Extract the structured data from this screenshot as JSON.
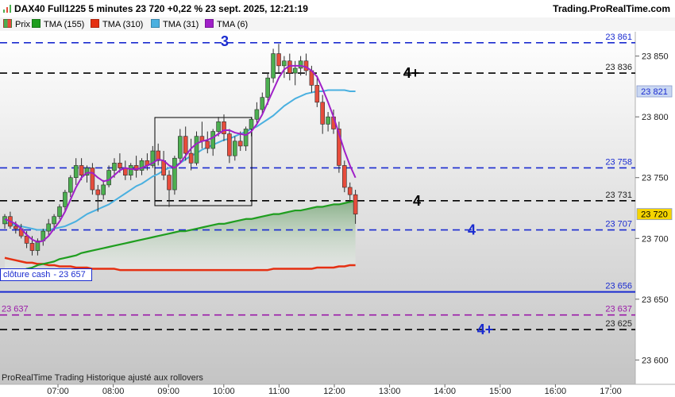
{
  "header": {
    "title": "DAX40 Full1225 5 minutes 23 720 +0,22 % 23 sept. 2025, 12:21:19",
    "source": "Trading.ProRealTime.com"
  },
  "legend": [
    {
      "label": "Prix",
      "color": "#4caf50"
    },
    {
      "label": "TMA (155)",
      "color": "#1f9e1f"
    },
    {
      "label": "TMA (310)",
      "color": "#e53012"
    },
    {
      "label": "TMA (31)",
      "color": "#4ab0e0"
    },
    {
      "label": "TMA (6)",
      "color": "#a020c8"
    }
  ],
  "footnote": "ProRealTime Trading  Historique ajusté aux rollovers",
  "cash_close": {
    "label": "clôture cash",
    "value": "23 657"
  },
  "colors": {
    "up": "#4caf50",
    "down": "#e74c3c",
    "blue_level": "#1a2bd0",
    "black_level": "#000000",
    "purple_level": "#9a1aa8",
    "tma155": "#1f9e1f",
    "tma310": "#e53012",
    "tma31": "#4ab0e0",
    "tma6": "#a020c8"
  },
  "chart_data": {
    "type": "candlestick",
    "y_axis": {
      "min": 23580,
      "max": 23870,
      "ticks": [
        23600,
        23650,
        23700,
        23750,
        23800,
        23850
      ],
      "tick_labels": [
        "23 600",
        "23 650",
        "23 700",
        "23 750",
        "23 800",
        "23 850"
      ]
    },
    "x_axis": {
      "ticks": [
        "07:00",
        "08:00",
        "09:00",
        "10:00",
        "11:00",
        "12:00",
        "13:00",
        "14:00",
        "15:00",
        "16:00",
        "17:00"
      ]
    },
    "levels": [
      {
        "value": 23861,
        "label": "23 861",
        "color": "#1a2bd0",
        "tag": "3",
        "style": "dashed"
      },
      {
        "value": 23836,
        "label": "23 836",
        "color": "#000000",
        "tag": "4+",
        "style": "dashed"
      },
      {
        "value": 23758,
        "label": "23 758",
        "color": "#1a2bd0",
        "tag": "",
        "style": "dashed"
      },
      {
        "value": 23731,
        "label": "23 731",
        "color": "#000000",
        "tag": "4",
        "style": "dashed"
      },
      {
        "value": 23707,
        "label": "23 707",
        "color": "#1a2bd0",
        "tag": "4",
        "style": "dashed"
      },
      {
        "value": 23656,
        "label": "23 656",
        "color": "#1a2bd0",
        "tag": "",
        "style": "solid"
      },
      {
        "value": 23637,
        "label": "23 637",
        "color": "#9a1aa8",
        "tag": "",
        "style": "dashed"
      },
      {
        "value": 23625,
        "label": "23 625",
        "color": "#000000",
        "tag": "4+",
        "style": "dashed"
      }
    ],
    "current_price": {
      "value": 23720,
      "label": "23 720"
    },
    "tma31_last": {
      "value": 23821,
      "label": "23 821"
    },
    "candles": [
      [
        23712,
        23720,
        23708,
        23718
      ],
      [
        23718,
        23722,
        23708,
        23710
      ],
      [
        23710,
        23714,
        23704,
        23708
      ],
      [
        23708,
        23712,
        23700,
        23702
      ],
      [
        23702,
        23706,
        23692,
        23696
      ],
      [
        23696,
        23702,
        23686,
        23690
      ],
      [
        23690,
        23700,
        23686,
        23698
      ],
      [
        23698,
        23708,
        23694,
        23706
      ],
      [
        23706,
        23716,
        23702,
        23712
      ],
      [
        23712,
        23720,
        23708,
        23718
      ],
      [
        23718,
        23728,
        23716,
        23726
      ],
      [
        23726,
        23740,
        23722,
        23738
      ],
      [
        23738,
        23752,
        23734,
        23750
      ],
      [
        23750,
        23766,
        23744,
        23760
      ],
      [
        23760,
        23766,
        23748,
        23752
      ],
      [
        23752,
        23760,
        23746,
        23758
      ],
      [
        23758,
        23762,
        23736,
        23740
      ],
      [
        23740,
        23744,
        23722,
        23736
      ],
      [
        23736,
        23748,
        23732,
        23744
      ],
      [
        23744,
        23760,
        23742,
        23756
      ],
      [
        23756,
        23766,
        23750,
        23762
      ],
      [
        23762,
        23770,
        23754,
        23758
      ],
      [
        23758,
        23764,
        23748,
        23752
      ],
      [
        23752,
        23762,
        23748,
        23760
      ],
      [
        23760,
        23768,
        23750,
        23756
      ],
      [
        23756,
        23766,
        23752,
        23764
      ],
      [
        23764,
        23770,
        23756,
        23760
      ],
      [
        23760,
        23776,
        23758,
        23772
      ],
      [
        23772,
        23778,
        23760,
        23764
      ],
      [
        23764,
        23772,
        23748,
        23752
      ],
      [
        23752,
        23756,
        23726,
        23740
      ],
      [
        23740,
        23768,
        23736,
        23766
      ],
      [
        23766,
        23790,
        23762,
        23784
      ],
      [
        23784,
        23792,
        23764,
        23770
      ],
      [
        23770,
        23782,
        23756,
        23762
      ],
      [
        23762,
        23788,
        23760,
        23784
      ],
      [
        23784,
        23796,
        23774,
        23780
      ],
      [
        23780,
        23788,
        23770,
        23774
      ],
      [
        23774,
        23790,
        23768,
        23788
      ],
      [
        23788,
        23800,
        23784,
        23796
      ],
      [
        23796,
        23802,
        23780,
        23786
      ],
      [
        23786,
        23790,
        23762,
        23768
      ],
      [
        23768,
        23784,
        23764,
        23780
      ],
      [
        23780,
        23788,
        23772,
        23776
      ],
      [
        23776,
        23792,
        23772,
        23790
      ],
      [
        23790,
        23800,
        23784,
        23798
      ],
      [
        23798,
        23812,
        23794,
        23806
      ],
      [
        23806,
        23820,
        23802,
        23816
      ],
      [
        23816,
        23836,
        23810,
        23832
      ],
      [
        23832,
        23856,
        23828,
        23852
      ],
      [
        23852,
        23860,
        23836,
        23842
      ],
      [
        23842,
        23850,
        23832,
        23846
      ],
      [
        23846,
        23852,
        23830,
        23836
      ],
      [
        23836,
        23846,
        23826,
        23840
      ],
      [
        23840,
        23850,
        23834,
        23846
      ],
      [
        23846,
        23852,
        23834,
        23838
      ],
      [
        23838,
        23842,
        23820,
        23826
      ],
      [
        23826,
        23834,
        23808,
        23812
      ],
      [
        23812,
        23818,
        23786,
        23794
      ],
      [
        23794,
        23804,
        23788,
        23800
      ],
      [
        23800,
        23806,
        23786,
        23790
      ],
      [
        23790,
        23796,
        23754,
        23760
      ],
      [
        23760,
        23764,
        23738,
        23742
      ],
      [
        23742,
        23746,
        23730,
        23736
      ],
      [
        23736,
        23740,
        23712,
        23720
      ]
    ],
    "series_tma6": [
      23716,
      23714,
      23712,
      23708,
      23703,
      23699,
      23697,
      23698,
      23702,
      23708,
      23714,
      23722,
      23732,
      23742,
      23750,
      23754,
      23754,
      23750,
      23747,
      23748,
      23752,
      23756,
      23758,
      23757,
      23757,
      23758,
      23760,
      23762,
      23765,
      23764,
      23760,
      23758,
      23762,
      23768,
      23774,
      23778,
      23780,
      23781,
      23783,
      23786,
      23789,
      23789,
      23787,
      23786,
      23785,
      23788,
      23794,
      23802,
      23812,
      23822,
      23832,
      23839,
      23842,
      23842,
      23842,
      23841,
      23838,
      23833,
      23823,
      23812,
      23800,
      23786,
      23772,
      23760,
      23750
    ],
    "series_tma31": [
      23713,
      23712,
      23711,
      23710,
      23709,
      23708,
      23707,
      23707,
      23707,
      23708,
      23709,
      23710,
      23712,
      23714,
      23717,
      23720,
      23722,
      23724,
      23726,
      23728,
      23731,
      23734,
      23737,
      23740,
      23743,
      23745,
      23748,
      23751,
      23753,
      23756,
      23758,
      23760,
      23762,
      23765,
      23768,
      23770,
      23773,
      23775,
      23777,
      23779,
      23781,
      23782,
      23784,
      23786,
      23788,
      23790,
      23792,
      23795,
      23798,
      23801,
      23805,
      23809,
      23812,
      23815,
      23817,
      23819,
      23820,
      23821,
      23821,
      23822,
      23822,
      23822,
      23822,
      23821,
      23821
    ],
    "series_tma155": [
      23668,
      23670,
      23672,
      23673,
      23675,
      23676,
      23678,
      23679,
      23680,
      23681,
      23683,
      23684,
      23685,
      23686,
      23688,
      23689,
      23690,
      23691,
      23692,
      23693,
      23694,
      23695,
      23696,
      23697,
      23698,
      23699,
      23700,
      23701,
      23702,
      23703,
      23704,
      23705,
      23706,
      23706,
      23707,
      23708,
      23709,
      23710,
      23711,
      23712,
      23712,
      23713,
      23714,
      23715,
      23716,
      23716,
      23717,
      23718,
      23719,
      23720,
      23720,
      23721,
      23722,
      23723,
      23723,
      23724,
      23725,
      23726,
      23726,
      23727,
      23728,
      23728,
      23729,
      23730,
      23731
    ],
    "series_tma310": [
      23684,
      23683,
      23682,
      23681,
      23680,
      23680,
      23679,
      23679,
      23678,
      23678,
      23677,
      23677,
      23677,
      23676,
      23676,
      23676,
      23675,
      23675,
      23675,
      23675,
      23675,
      23674,
      23674,
      23674,
      23674,
      23674,
      23674,
      23674,
      23674,
      23674,
      23674,
      23674,
      23674,
      23674,
      23674,
      23674,
      23674,
      23674,
      23674,
      23674,
      23674,
      23674,
      23674,
      23674,
      23674,
      23674,
      23674,
      23674,
      23674,
      23675,
      23675,
      23675,
      23675,
      23675,
      23675,
      23675,
      23675,
      23676,
      23676,
      23676,
      23676,
      23677,
      23677,
      23678,
      23678
    ]
  }
}
